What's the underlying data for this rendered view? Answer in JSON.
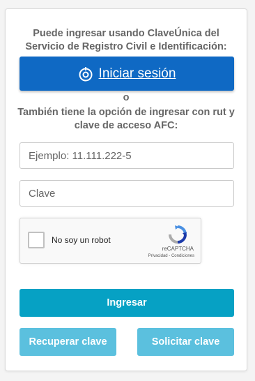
{
  "intro_text": "Puede ingresar usando ClaveÚnica del Servicio de Registro Civil e Identificación:",
  "claveunica_button": {
    "label": "Iniciar sesión",
    "icon": "claveunica-icon"
  },
  "separator": "o",
  "alt_text": "También tiene la opción de ingresar con rut y clave de acceso AFC:",
  "rut_field": {
    "placeholder": "Ejemplo: 11.111.222-5",
    "value": ""
  },
  "password_field": {
    "placeholder": "Clave",
    "value": ""
  },
  "captcha": {
    "checkbox_label": "No soy un robot",
    "brand": "reCAPTCHA",
    "terms": "Privacidad - Condiciones",
    "checked": false
  },
  "buttons": {
    "login": "Ingresar",
    "recover": "Recuperar clave",
    "request": "Solicitar clave"
  },
  "colors": {
    "claveunica_blue": "#0f69c4",
    "primary": "#06a1c4",
    "secondary": "#5bc0de",
    "text": "#666666"
  }
}
